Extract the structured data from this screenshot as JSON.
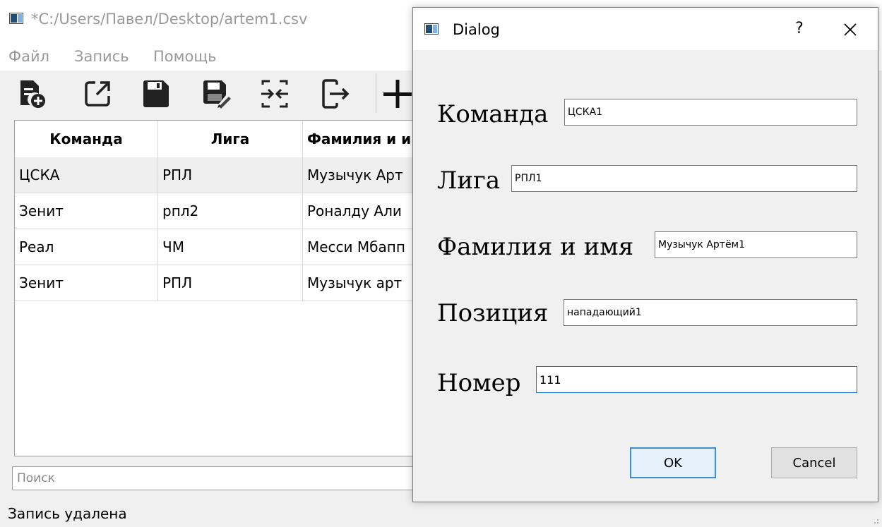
{
  "window": {
    "title": "*C:/Users/Павел/Desktop/artem1.csv"
  },
  "menu": {
    "items": [
      "Файл",
      "Запись",
      "Помощь"
    ]
  },
  "toolbar": {
    "buttons": [
      "new-file-icon",
      "open-external-icon",
      "save-icon",
      "save-as-icon",
      "merge-icon",
      "exit-icon",
      "add-icon"
    ]
  },
  "table": {
    "columns": [
      "Команда",
      "Лига",
      "Фамилия и и"
    ],
    "rows": [
      [
        "ЦСКА",
        "РПЛ",
        "Музычук Арт"
      ],
      [
        "Зенит",
        "рпл2",
        "Роналду Али"
      ],
      [
        "Реал",
        "ЧМ",
        "Месси Мбапп"
      ],
      [
        "Зенит",
        "РПЛ",
        "Музычук арт"
      ]
    ]
  },
  "search": {
    "placeholder": "Поиск"
  },
  "status": {
    "text": "Запись удалена"
  },
  "dialog": {
    "title": "Dialog",
    "help": "?",
    "fields": {
      "team": {
        "label": "Команда",
        "value": "ЦСКА1"
      },
      "league": {
        "label": "Лига",
        "value": "РПЛ1"
      },
      "name": {
        "label": "Фамилия и имя",
        "value": "Музычук Артём1"
      },
      "position": {
        "label": "Позиция",
        "value": "нападающий1"
      },
      "number": {
        "label": "Номер",
        "value": "111"
      }
    },
    "ok_label": "OK",
    "cancel_label": "Cancel"
  },
  "colors": {
    "accent": "#1a75d0",
    "default_button_border": "#3c8ddb",
    "menu_text": "#999999"
  }
}
